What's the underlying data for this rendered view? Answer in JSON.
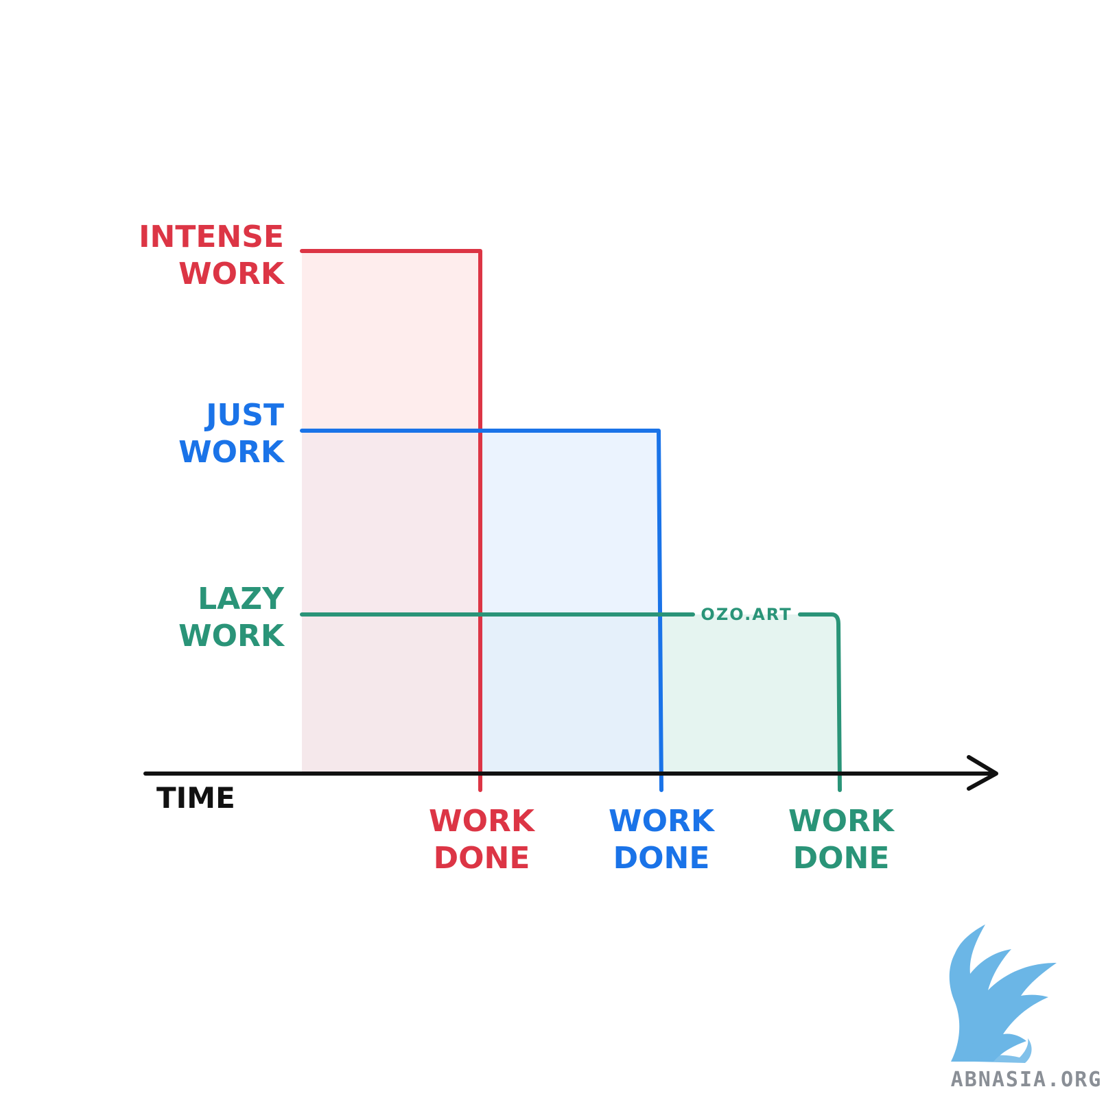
{
  "colors": {
    "intense": "#dc3545",
    "just": "#1a73e8",
    "lazy": "#2a9478",
    "axis": "#111111",
    "intense_fill": "#fde3e4",
    "just_fill": "#e4effd",
    "lazy_fill": "#e2f3ee",
    "logo": "#6bb6e6",
    "logo_text": "#8a8f96"
  },
  "axis": {
    "label": "TIME"
  },
  "levels": [
    {
      "id": "intense",
      "label_line1": "INTENSE",
      "label_line2": "WORK",
      "intensity": 3,
      "done_time": 1
    },
    {
      "id": "just",
      "label_line1": "JUST",
      "label_line2": "WORK",
      "intensity": 2,
      "done_time": 2
    },
    {
      "id": "lazy",
      "label_line1": "LAZY",
      "label_line2": "WORK",
      "intensity": 1,
      "done_time": 3
    }
  ],
  "done_labels": [
    {
      "id": "intense",
      "line1": "WORK",
      "line2": "DONE"
    },
    {
      "id": "just",
      "line1": "WORK",
      "line2": "DONE"
    },
    {
      "id": "lazy",
      "line1": "WORK",
      "line2": "DONE"
    }
  ],
  "credit": "OZO.ART",
  "watermark": "ABNASIA.ORG"
}
